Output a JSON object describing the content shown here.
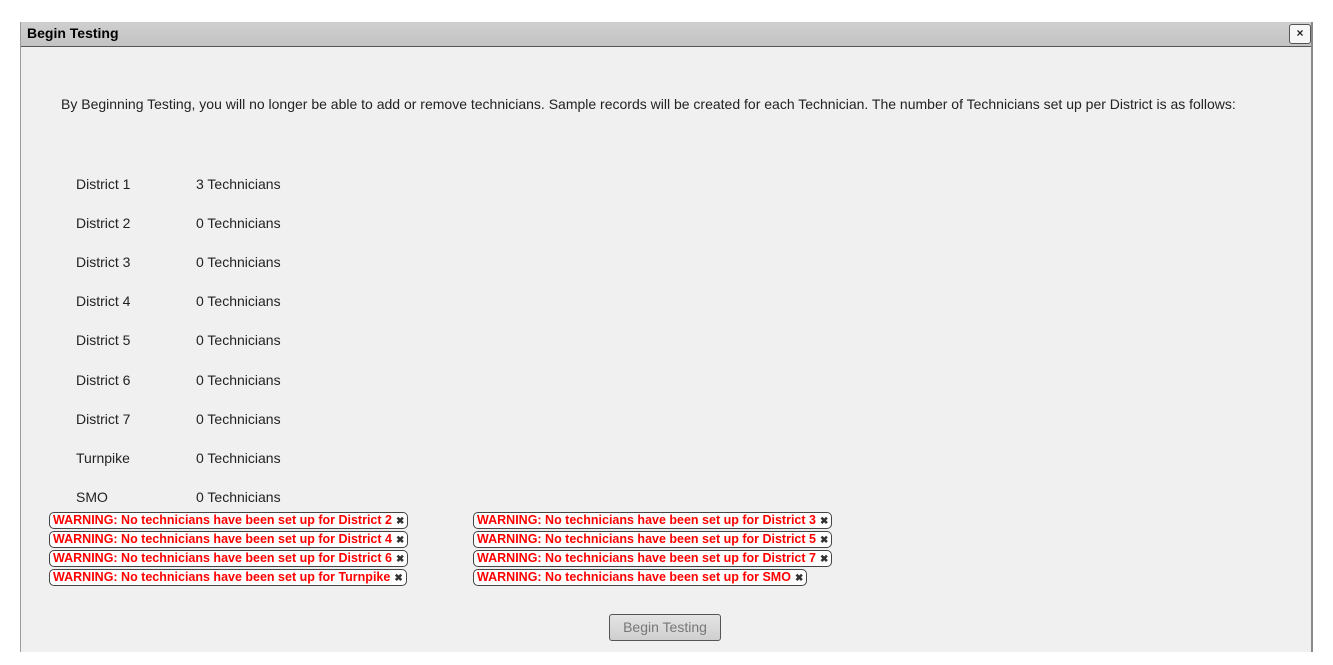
{
  "dialog": {
    "title": "Begin Testing",
    "close_label": "×",
    "intro_text": "By Beginning Testing, you will no longer be able to add or remove technicians. Sample records will be created for each Technician. The number of Technicians set up per District is as follows:",
    "districts": [
      {
        "name": "District 1",
        "count": "3 Technicians"
      },
      {
        "name": "District 2",
        "count": "0 Technicians"
      },
      {
        "name": "District 3",
        "count": "0 Technicians"
      },
      {
        "name": "District 4",
        "count": "0 Technicians"
      },
      {
        "name": "District 5",
        "count": "0 Technicians"
      },
      {
        "name": "District 6",
        "count": "0 Technicians"
      },
      {
        "name": "District 7",
        "count": "0 Technicians"
      },
      {
        "name": "Turnpike",
        "count": "0 Technicians"
      },
      {
        "name": "SMO",
        "count": "0 Technicians"
      }
    ],
    "warnings": [
      "WARNING: No technicians have been set up for District 2",
      "WARNING: No technicians have been set up for District 3",
      "WARNING: No technicians have been set up for District 4",
      "WARNING: No technicians have been set up for District 5",
      "WARNING: No technicians have been set up for District 6",
      "WARNING: No technicians have been set up for District 7",
      "WARNING: No technicians have been set up for Turnpike",
      "WARNING: No technicians have been set up for SMO"
    ],
    "warning_dismiss": "✖",
    "begin_button_label": "Begin Testing"
  },
  "colors": {
    "warning_text": "#ff0000",
    "dialog_bg": "#f0f0f0",
    "titlebar_bg": "#c8c8c8"
  }
}
